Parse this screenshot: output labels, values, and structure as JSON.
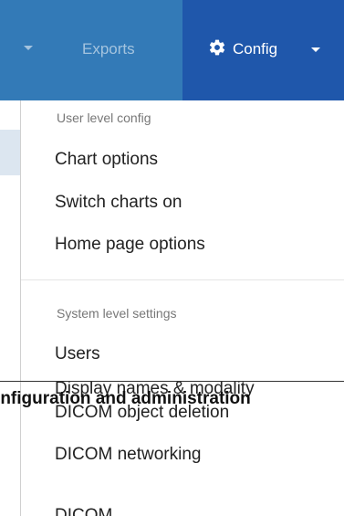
{
  "navbar": {
    "prev_item_caret": "caret-down-icon",
    "exports_label": "Exports",
    "config": {
      "label": "Config",
      "icon": "gear-icon",
      "caret": "caret-down-icon"
    },
    "colors": {
      "bar": "#337ab7",
      "active": "#1f57ab"
    }
  },
  "dropdown": {
    "user_header": "User level config",
    "user_items": [
      "Chart options",
      "Switch charts on",
      "Home page options"
    ],
    "system_header": "System level settings",
    "system_items": [
      "Users",
      "Display names & modality",
      "DICOM object deletion",
      "DICOM networking",
      "DICOM"
    ]
  },
  "overlay": {
    "heading": "Configuration and administration"
  }
}
